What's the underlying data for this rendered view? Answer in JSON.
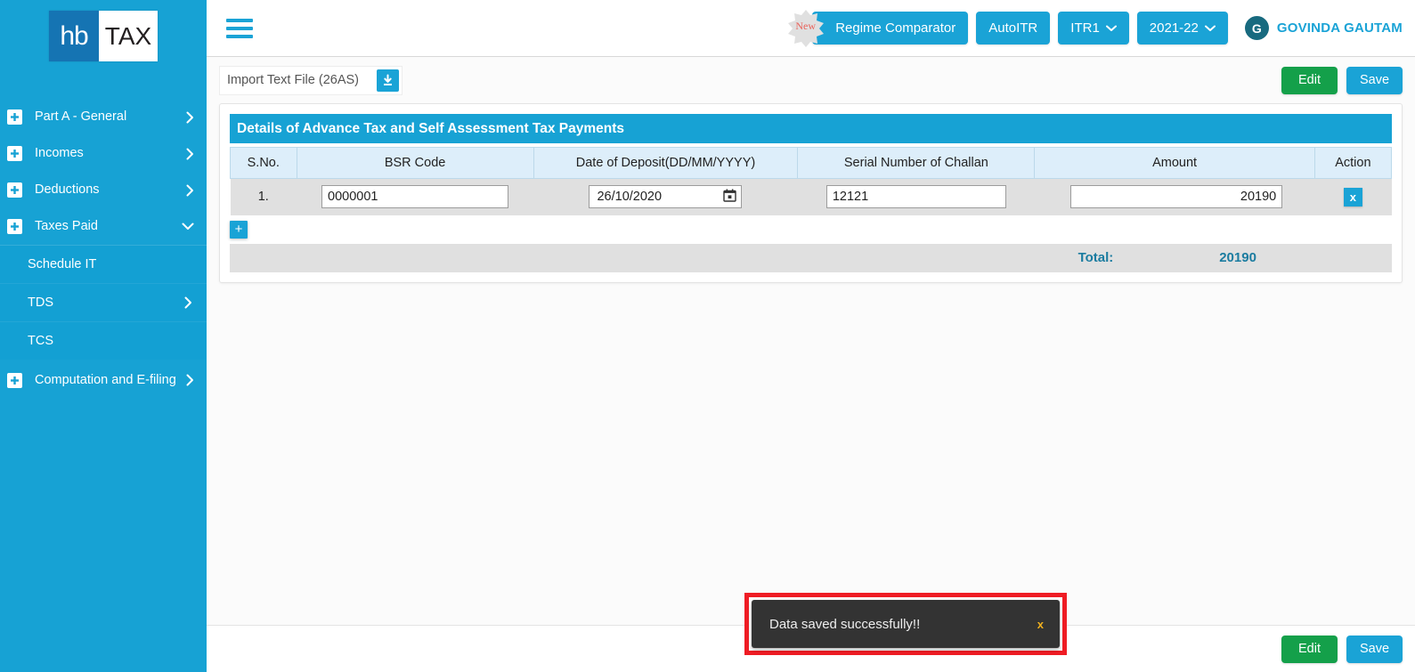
{
  "brand": {
    "logo_left": "hb",
    "logo_right": "TAX",
    "accent_blue": "#1aa3d6",
    "sidebar_blue": "#17a2d4",
    "logo_blue": "#1574b3",
    "green": "#14a04a",
    "toast_bg": "#333333",
    "highlight_red": "#ef1c24"
  },
  "sidebar": {
    "items": [
      {
        "label": "Part A - General",
        "icon": "plus-square-icon",
        "chevron": "chevron-right-icon",
        "expanded": false
      },
      {
        "label": "Incomes",
        "icon": "plus-square-icon",
        "chevron": "chevron-right-icon",
        "expanded": false
      },
      {
        "label": "Deductions",
        "icon": "plus-square-icon",
        "chevron": "chevron-right-icon",
        "expanded": false
      },
      {
        "label": "Taxes Paid",
        "icon": "plus-square-icon",
        "chevron": "chevron-down-icon",
        "expanded": true
      }
    ],
    "submenu": [
      {
        "label": "Schedule IT",
        "chevron": "",
        "active": true
      },
      {
        "label": "TDS",
        "chevron": "chevron-right-icon",
        "active": false
      },
      {
        "label": "TCS",
        "chevron": "",
        "active": false
      }
    ],
    "items_after": [
      {
        "label": "Computation and E-filing",
        "icon": "plus-square-icon",
        "chevron": "chevron-right-icon",
        "expanded": false
      }
    ]
  },
  "topbar": {
    "menu_icon": "hamburger-icon",
    "new_badge": "New",
    "regime_comparator": "Regime Comparator",
    "autoitr": "AutoITR",
    "form_type": "ITR1",
    "assessment_year": "2021-22",
    "avatar_initial": "G",
    "user_name": "GOVINDA GAUTAM"
  },
  "actionbar": {
    "import_label": "Import Text File (26AS)",
    "import_icon": "download-icon",
    "edit_label": "Edit",
    "save_label": "Save"
  },
  "panel": {
    "title": "Details of Advance Tax and Self Assessment Tax Payments",
    "columns": [
      "S.No.",
      "BSR Code",
      "Date of Deposit(DD/MM/YYYY)",
      "Serial Number of Challan",
      "Amount",
      "Action"
    ],
    "rows": [
      {
        "sno": "1.",
        "bsr_code": "0000001",
        "date_of_deposit": "26/10/2020",
        "serial_number": "12121",
        "amount": "20190",
        "delete_label": "x"
      }
    ],
    "add_row_label": "+",
    "total_label": "Total:",
    "total_value": "20190"
  },
  "toast": {
    "message": "Data saved successfully!!",
    "close_label": "x"
  },
  "footer": {
    "edit_label": "Edit",
    "save_label": "Save"
  }
}
